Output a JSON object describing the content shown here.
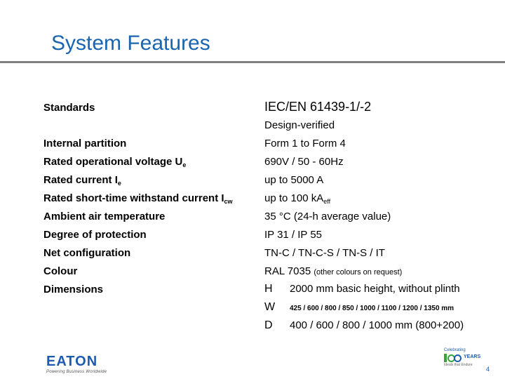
{
  "header": {
    "title": "System Features"
  },
  "features": {
    "standards": {
      "label": "Standards",
      "value": "IEC/EN 61439-1/-2",
      "note": "Design-verified"
    },
    "partition": {
      "label": "Internal partition",
      "value": "Form 1 to Form 4"
    },
    "voltage": {
      "label": "Rated operational voltage U",
      "label_sub": "e",
      "value": "690V / 50 - 60Hz"
    },
    "current": {
      "label": "Rated current I",
      "label_sub": "e",
      "value": "up to 5000 A"
    },
    "shorttime": {
      "label": "Rated short-time withstand current I",
      "label_sub": "cw",
      "value": "up to 100 kA",
      "value_sub": "eff"
    },
    "ambient": {
      "label": "Ambient air temperature",
      "value": "35 °C  (24-h average value)"
    },
    "protection": {
      "label": "Degree of protection",
      "value": "IP 31 / IP 55"
    },
    "net": {
      "label": "Net configuration",
      "value": "TN-C / TN-C-S / TN-S / IT"
    },
    "colour": {
      "label": "Colour",
      "value": "RAL 7035",
      "value_note": "(other colours on request)"
    },
    "dimensions": {
      "label": "Dimensions",
      "h_key": "H",
      "h_value": "2000 mm basic height, without plinth",
      "w_key": "W",
      "w_value": "425 / 600 / 800 / 850 / 1000 / 1100 / 1200 / 1350 mm",
      "d_key": "D",
      "d_value": "400 / 600 / 800 / 1000 mm (800+200)"
    }
  },
  "footer": {
    "brand": "E·A·T·O·N",
    "brand_text": "EATON",
    "tagline": "Powering Business Worldwide",
    "anniversary_top": "Celebrating",
    "anniversary_years": "YEARS",
    "anniversary_bottom": "Ideals that Endure",
    "page_number": "4"
  },
  "colors": {
    "title": "#1a64b0",
    "rule": "#808080",
    "brand_blue": "#1e5bb0",
    "brand_green": "#3ca03c"
  }
}
